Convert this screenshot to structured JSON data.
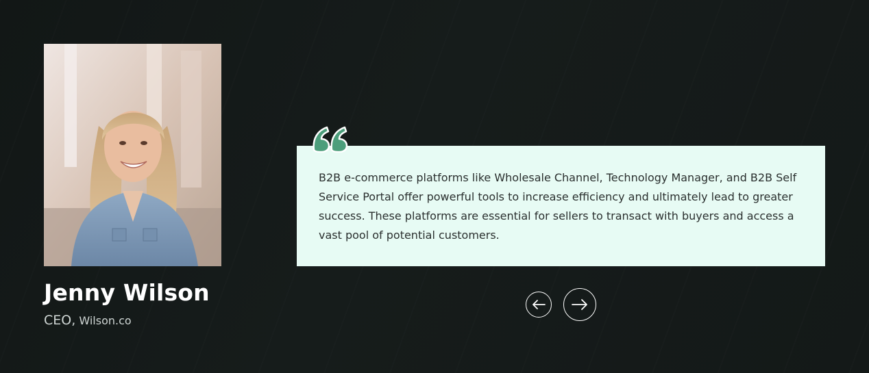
{
  "testimonial": {
    "name": "Jenny Wilson",
    "role_title": "CEO,",
    "role_company": "Wilson.co",
    "quote": "B2B e-commerce platforms like Wholesale Channel, Technology Manager, and B2B Self Service Portal offer powerful tools to increase efficiency and ultimately lead to greater success. These platforms are essential for sellers to transact with buyers and access a vast pool of potential customers."
  },
  "navigation": {
    "prev_icon": "arrow-left-icon",
    "next_icon": "arrow-right-icon"
  },
  "colors": {
    "background": "#141918",
    "quote_box": "#e7fbf4",
    "accent": "#4c9e7b",
    "text_light": "#ffffff"
  }
}
